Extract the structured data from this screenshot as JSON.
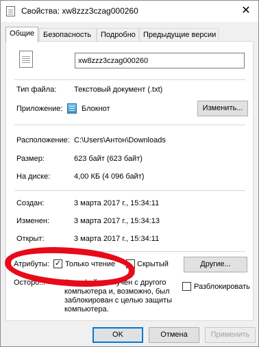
{
  "window": {
    "title": "Свойства: xw8zzz3czag000260",
    "close_glyph": "✕"
  },
  "tabs": [
    {
      "label": "Общие",
      "active": true
    },
    {
      "label": "Безопасность",
      "active": false
    },
    {
      "label": "Подробно",
      "active": false
    },
    {
      "label": "Предыдущие версии",
      "active": false
    }
  ],
  "file": {
    "name_value": "xw8zzz3czag000260",
    "icon": "text-file-icon"
  },
  "type_section": {
    "type_label": "Тип файла:",
    "type_value": "Текстовый документ (.txt)",
    "app_label": "Приложение:",
    "app_icon": "notepad-icon",
    "app_value": "Блокнот",
    "change_button": "Изменить..."
  },
  "location_section": {
    "location_label": "Расположение:",
    "location_value": "C:\\Users\\Антон\\Downloads",
    "size_label": "Размер:",
    "size_value": "623 байт (623 байт)",
    "disk_label": "На диске:",
    "disk_value": "4,00 КБ (4 096 байт)"
  },
  "dates_section": {
    "created_label": "Создан:",
    "created_value": "3 марта 2017 г., 15:34:11",
    "modified_label": "Изменен:",
    "modified_value": "3 марта 2017 г., 15:34:13",
    "opened_label": "Открыт:",
    "opened_value": "3 марта 2017 г., 15:34:11"
  },
  "attributes": {
    "label": "Атрибуты:",
    "readonly_label": "Только чтение",
    "readonly_checked": true,
    "hidden_label": "Скрытый",
    "hidden_checked": false,
    "other_button": "Другие...",
    "security_label": "Осторо...",
    "security_text": "Этот файл получен с другого компьютера и, возможно, был заблокирован с целью защиты компьютера.",
    "unblock_label": "Разблокировать",
    "unblock_checked": false
  },
  "footer": {
    "ok": "OK",
    "cancel": "Отмена",
    "apply": "Применить"
  },
  "colors": {
    "annotation_red": "#e8091a",
    "accent": "#0078d7"
  }
}
